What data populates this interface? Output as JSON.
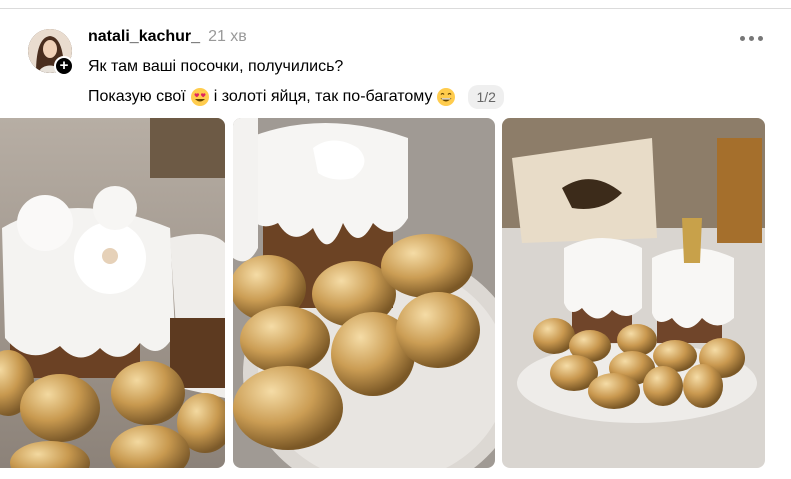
{
  "post": {
    "username": "natali_kachur_",
    "time": "21 хв",
    "line1": "Як там ваші посочки, получились?",
    "line2_a": "Показую свої",
    "line2_b": "і золоті яйця, так по-багатому",
    "counter": "1/2",
    "icons": {
      "more": "more-horizontal-icon",
      "follow": "plus-icon",
      "emoji1": "heart-eyes-emoji",
      "emoji2": "grinning-emoji"
    }
  },
  "colors": {
    "gold": "#c9a15a",
    "icing": "#f4f4f2",
    "plate": "#e6e3de",
    "muted": "#999999"
  }
}
